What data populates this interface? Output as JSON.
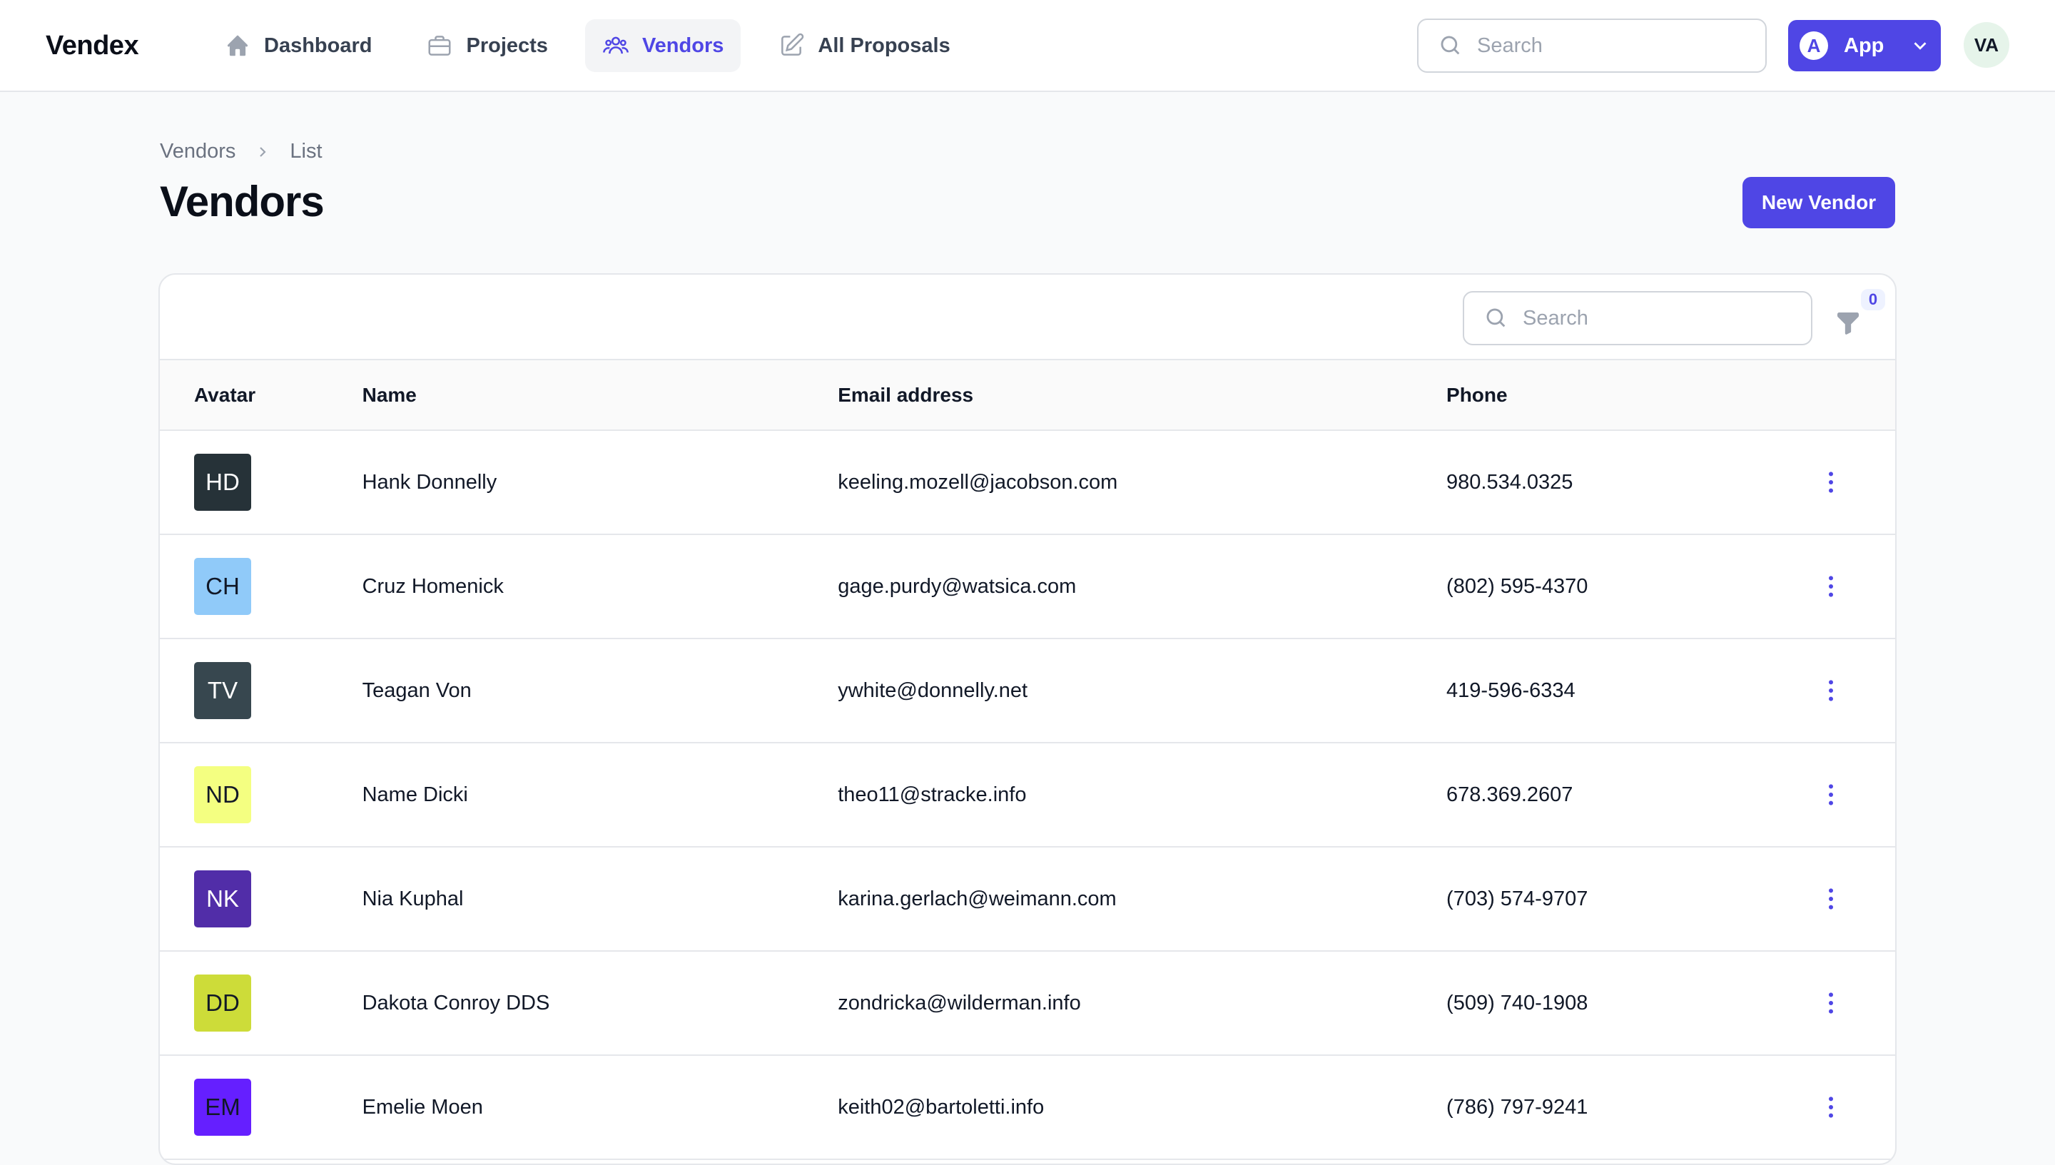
{
  "app": {
    "brand": "Vendex"
  },
  "nav": {
    "items": [
      {
        "label": "Dashboard",
        "icon": "home-icon",
        "active": false
      },
      {
        "label": "Projects",
        "icon": "briefcase-icon",
        "active": false
      },
      {
        "label": "Vendors",
        "icon": "users-icon",
        "active": true
      },
      {
        "label": "All Proposals",
        "icon": "pencil-square-icon",
        "active": false
      }
    ]
  },
  "header": {
    "search_placeholder": "Search",
    "app_switcher": {
      "initial": "A",
      "label": "App"
    },
    "user_initials": "VA"
  },
  "page": {
    "breadcrumb": [
      "Vendors",
      "List"
    ],
    "title": "Vendors",
    "new_button_label": "New Vendor"
  },
  "table": {
    "search_placeholder": "Search",
    "filter_count": "0",
    "columns": [
      "Avatar",
      "Name",
      "Email address",
      "Phone"
    ],
    "rows": [
      {
        "initials": "HD",
        "avatar_bg": "#263238",
        "avatar_fg": "#ffffff",
        "name": "Hank Donnelly",
        "email": "keeling.mozell@jacobson.com",
        "phone": "980.534.0325"
      },
      {
        "initials": "CH",
        "avatar_bg": "#90caf9",
        "avatar_fg": "#111827",
        "name": "Cruz Homenick",
        "email": "gage.purdy@watsica.com",
        "phone": "(802) 595-4370"
      },
      {
        "initials": "TV",
        "avatar_bg": "#37474f",
        "avatar_fg": "#ffffff",
        "name": "Teagan Von",
        "email": "ywhite@donnelly.net",
        "phone": "419-596-6334"
      },
      {
        "initials": "ND",
        "avatar_bg": "#f4ff81",
        "avatar_fg": "#111827",
        "name": "Name Dicki",
        "email": "theo11@stracke.info",
        "phone": "678.369.2607"
      },
      {
        "initials": "NK",
        "avatar_bg": "#512da8",
        "avatar_fg": "#ffffff",
        "name": "Nia Kuphal",
        "email": "karina.gerlach@weimann.com",
        "phone": "(703) 574-9707"
      },
      {
        "initials": "DD",
        "avatar_bg": "#cddc39",
        "avatar_fg": "#111827",
        "name": "Dakota Conroy DDS",
        "email": "zondricka@wilderman.info",
        "phone": "(509) 740-1908"
      },
      {
        "initials": "EM",
        "avatar_bg": "#651fff",
        "avatar_fg": "#111827",
        "name": "Emelie Moen",
        "email": "keith02@bartoletti.info",
        "phone": "(786) 797-9241"
      }
    ]
  },
  "colors": {
    "accent": "#4f46e5",
    "border": "#e5e7eb",
    "background": "#f9fafb"
  }
}
